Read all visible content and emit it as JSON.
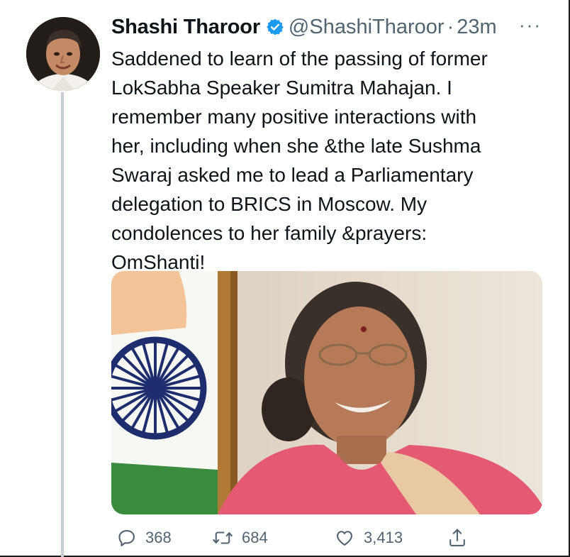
{
  "tweet": {
    "display_name": "Shashi Tharoor",
    "handle": "@ShashiTharoor",
    "separator": "·",
    "time": "23m",
    "more": "···",
    "text": "Saddened to learn of the passing of former\nLokSabha Speaker Sumitra Mahajan. I\nremember many positive interactions with\nher, including when she &the late Sushma\nSwaraj asked me to lead a Parliamentary\ndelegation to BRICS in Moscow. My\ncondolences to her family &prayers:\nOmShanti!"
  },
  "icons": {
    "verified": "verified-badge-icon",
    "reply": "reply-icon",
    "retweet": "retweet-icon",
    "like": "heart-icon",
    "share": "share-icon"
  },
  "actions": {
    "replies": "368",
    "retweets": "684",
    "likes": "3,413"
  },
  "colors": {
    "verified_blue": "#1d9bf0",
    "secondary_text": "#536471",
    "thread_line": "#c9cdd1"
  }
}
